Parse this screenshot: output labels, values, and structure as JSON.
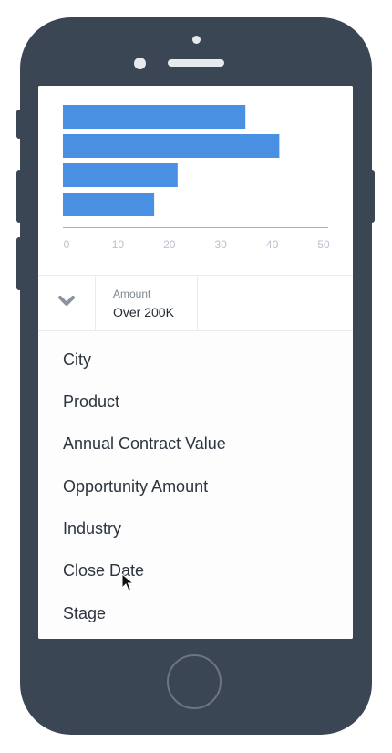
{
  "chart_data": {
    "type": "bar",
    "orientation": "horizontal",
    "values": [
      35,
      41.5,
      22,
      17.5
    ],
    "xticks": [
      "0",
      "10",
      "20",
      "30",
      "40",
      "50"
    ],
    "xlim": [
      0,
      50
    ],
    "grid": false,
    "bar_color": "#4a90e2"
  },
  "filter": {
    "label": "Amount",
    "value": "Over 200K",
    "collapse_icon": "chevron-down-icon"
  },
  "dropdown": {
    "items": [
      "City",
      "Product",
      "Annual Contract Value",
      "Opportunity Amount",
      "Industry",
      "Close Date",
      "Stage"
    ]
  },
  "colors": {
    "device": "#3b4655",
    "accent": "#4a90e2",
    "text": "#2c3440",
    "muted": "#7d8794"
  }
}
